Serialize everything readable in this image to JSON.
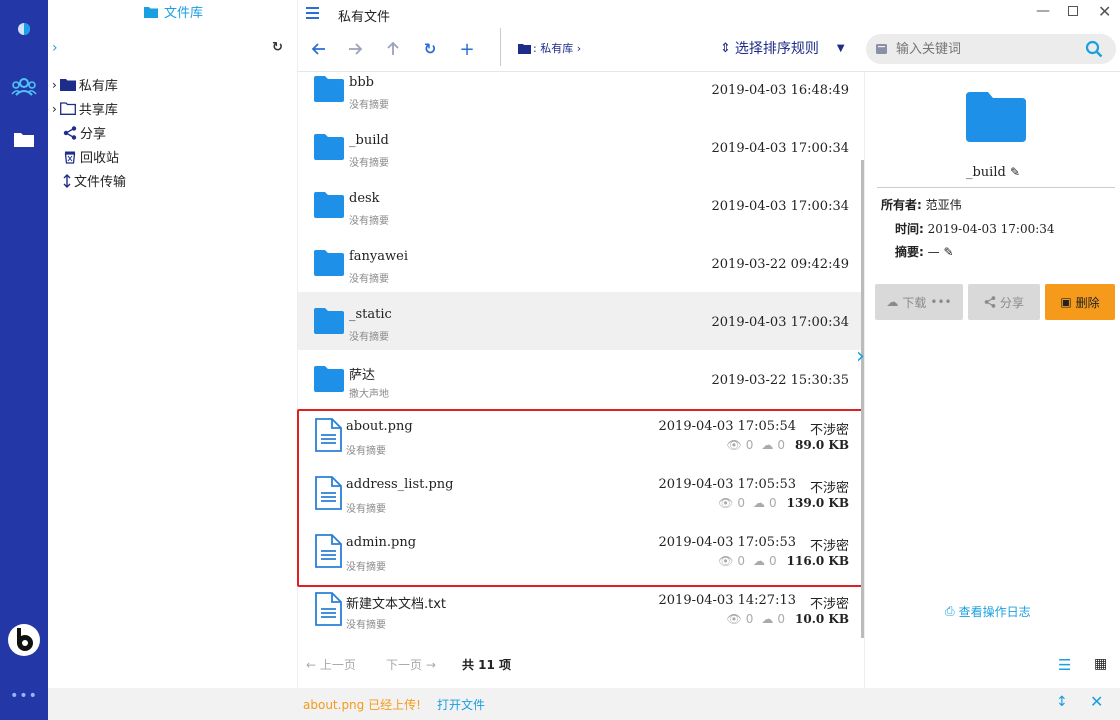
{
  "app": {
    "tree_title": "文件库",
    "window_title": "私有文件"
  },
  "tree": {
    "items": [
      {
        "label": "私有库",
        "icon": "folder-filled-icon"
      },
      {
        "label": "共享库",
        "icon": "folder-outline-icon"
      },
      {
        "label": "分享",
        "icon": "share-icon"
      },
      {
        "label": "回收站",
        "icon": "recycle-bin-icon"
      },
      {
        "label": "文件传输",
        "icon": "transfer-icon"
      }
    ]
  },
  "toolbar": {
    "breadcrumb": ": 私有库 ›",
    "sort_label": "选择排序规则",
    "search_placeholder": "输入关键词"
  },
  "files": [
    {
      "name": "bbb",
      "summary": "没有摘要",
      "date": "2019-04-03 16:48:49",
      "type": "folder"
    },
    {
      "name": "_build",
      "summary": "没有摘要",
      "date": "2019-04-03 17:00:34",
      "type": "folder"
    },
    {
      "name": "desk",
      "summary": "没有摘要",
      "date": "2019-04-03 17:00:34",
      "type": "folder"
    },
    {
      "name": "fanyawei",
      "summary": "没有摘要",
      "date": "2019-03-22 09:42:49",
      "type": "folder"
    },
    {
      "name": "_static",
      "summary": "没有摘要",
      "date": "2019-04-03 17:00:34",
      "type": "folder",
      "selected": true
    },
    {
      "name": "萨达",
      "summary": "撒大声地",
      "date": "2019-03-22 15:30:35",
      "type": "folder"
    },
    {
      "name": "about.png",
      "summary": "没有摘要",
      "date": "2019-04-03 17:05:54",
      "security": "不涉密",
      "views": "0",
      "downloads": "0",
      "size": "89.0 KB",
      "type": "file"
    },
    {
      "name": "address_list.png",
      "summary": "没有摘要",
      "date": "2019-04-03 17:05:53",
      "security": "不涉密",
      "views": "0",
      "downloads": "0",
      "size": "139.0 KB",
      "type": "file"
    },
    {
      "name": "admin.png",
      "summary": "没有摘要",
      "date": "2019-04-03 17:05:53",
      "security": "不涉密",
      "views": "0",
      "downloads": "0",
      "size": "116.0 KB",
      "type": "file"
    },
    {
      "name": "新建文本文档.txt",
      "summary": "没有摘要",
      "date": "2019-04-03 14:27:13",
      "security": "不涉密",
      "views": "0",
      "downloads": "0",
      "size": "10.0 KB",
      "type": "file"
    }
  ],
  "detail": {
    "name": "_build",
    "owner_label": "所有者:",
    "owner": "范亚伟",
    "time_label": "时间:",
    "time": "2019-04-03 17:00:34",
    "summary_label": "摘要:",
    "summary": "—",
    "download_label": "下载",
    "share_label": "分享",
    "delete_label": "删除",
    "log_label": "查看操作日志"
  },
  "pager": {
    "prev": "上一页",
    "next": "下一页",
    "total": "共 11 项"
  },
  "status": {
    "message": "about.png 已经上传!",
    "open_label": "打开文件"
  },
  "colors": {
    "rail": "#2338a6",
    "accent": "#1a9fe0",
    "folder": "#1e90e8",
    "delete": "#f59a1a",
    "highlight": "#e02020"
  }
}
